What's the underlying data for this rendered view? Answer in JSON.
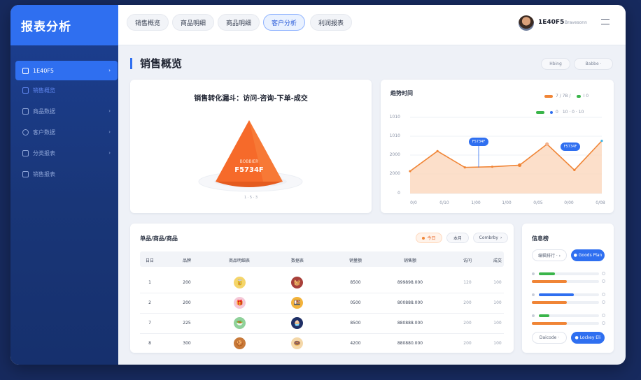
{
  "brand": {
    "title": "报表分析"
  },
  "sidebar": {
    "items": [
      {
        "label": "1E40F5",
        "active": true,
        "chevron": "›"
      },
      {
        "label": "销售概览",
        "chevron": ""
      },
      {
        "label": "商品数据",
        "chevron": "›"
      },
      {
        "label": "客户数据",
        "chevron": "›"
      },
      {
        "label": "分类报表",
        "chevron": "›"
      },
      {
        "label": "销售报表",
        "chevron": ""
      }
    ]
  },
  "topbar": {
    "tabs": [
      "销售概览",
      "商品明细",
      "商品明细",
      "客户分析",
      "利润报表"
    ],
    "active_tab": 3,
    "user": {
      "name": "1E40F5",
      "subtitle": "Bravesonn"
    }
  },
  "page": {
    "title": "销售概览",
    "header_buttons": [
      "Hbing",
      "Babbe ·"
    ]
  },
  "funnel": {
    "title": "销售转化漏斗：访问-咨询-下单-成交",
    "label_small": "BOBBIER",
    "label_big": "F5734F",
    "note": "1 · 5  · 3"
  },
  "trend": {
    "title": "趋势时间",
    "legend_top": [
      "7 / 7B /",
      "I 0"
    ],
    "legend_second": [
      "0",
      "10 · 0 · 10"
    ],
    "callouts": [
      "F5734F",
      "F5734F"
    ],
    "colors": {
      "line": "#f08536",
      "fill": "#fbd7bd",
      "green": "#3ab54a",
      "blue": "#2f6ff0"
    }
  },
  "chart_data": {
    "type": "area",
    "x": [
      "0/0",
      "0/10",
      "1/00",
      "1/00",
      "0/05",
      "0/00",
      "0/08"
    ],
    "values": [
      1000,
      1900,
      1170,
      1200,
      1270,
      2210,
      1050,
      2360
    ],
    "yticks": [
      "1010",
      "1010",
      "2000",
      "2000",
      "0"
    ],
    "ylim": [
      0,
      3600
    ]
  },
  "table": {
    "title": "单品/商品/商品",
    "filters": {
      "today": "今日",
      "month": "本月",
      "dropdown": "Combrby"
    },
    "columns": [
      "日日",
      "品牌",
      "商品明细表",
      "数据表",
      "销量额",
      "销售额",
      "访问",
      "成交"
    ],
    "rows": [
      {
        "c1": "1",
        "c2": "200",
        "icon1": "🥫",
        "icon2": "🧺",
        "c5": "8500",
        "c6": "899898.000",
        "c7": "120",
        "c8": "100"
      },
      {
        "c1": "2",
        "c2": "200",
        "icon1": "🎁",
        "icon2": "🍱",
        "c5": "0500",
        "c6": "800888.000",
        "c7": "200",
        "c8": "100"
      },
      {
        "c1": "7",
        "c2": "225",
        "icon1": "🥗",
        "icon2": "🧁",
        "c5": "8500",
        "c6": "880888.000",
        "c7": "200",
        "c8": "100"
      },
      {
        "c1": "8",
        "c2": "300",
        "icon1": "🍪",
        "icon2": "🍩",
        "c5": "4200",
        "c6": "880880.000",
        "c7": "200",
        "c8": "100"
      }
    ]
  },
  "ranking": {
    "title": "信息榜",
    "btn_left": "编辑排行 · ›",
    "btn_right": "● Goods Plan",
    "bottom_left": "Daicode ·",
    "bottom_right": "● Lockey Eli",
    "bars": [
      {
        "track": 0.27,
        "track_color": "#3ab54a",
        "value": 0.52,
        "value_color": "#f08536"
      },
      {
        "track": 0.58,
        "track_color": "#2f6ff0",
        "value": 0.52,
        "value_color": "#f08536"
      },
      {
        "track": 0.17,
        "track_color": "#3ab54a",
        "value": 0.52,
        "value_color": "#f08536"
      }
    ]
  }
}
